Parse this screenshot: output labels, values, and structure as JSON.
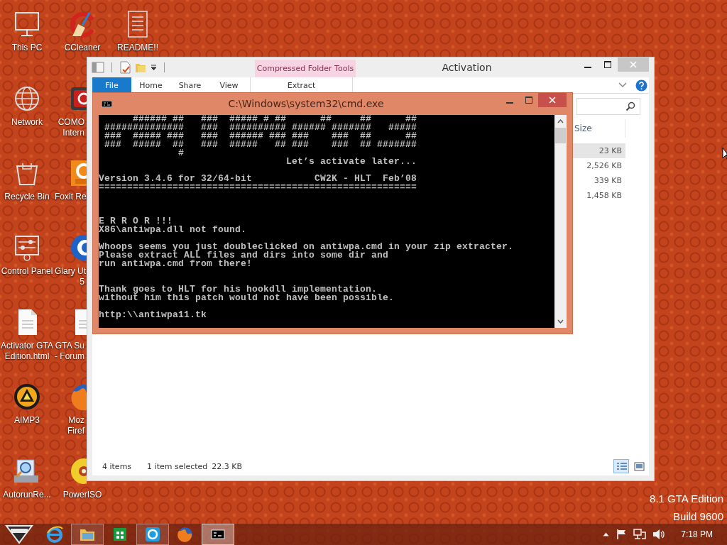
{
  "desktop": {
    "icons": [
      {
        "label": "This PC",
        "cut": false,
        "icon_covered": false
      },
      {
        "label": "Network",
        "cut": false,
        "icon_covered": false
      },
      {
        "label": "Recycle Bin",
        "cut": false,
        "icon_covered": false
      },
      {
        "label": "Control Panel",
        "cut": false,
        "icon_covered": false
      },
      {
        "label": "Activator GTA\nEdition.html",
        "cut": false,
        "icon_covered": false
      },
      {
        "label": "AIMP3",
        "cut": false,
        "icon_covered": false
      },
      {
        "label": "AutorunRe...",
        "cut": false,
        "icon_covered": false
      },
      {
        "label": "CCleaner",
        "cut": false,
        "icon_covered": false
      },
      {
        "label": "COMO\nIntern",
        "cut": true,
        "icon_covered": true
      },
      {
        "label": "Foxit Re",
        "cut": true,
        "icon_covered": true
      },
      {
        "label": "Glary Ut\n5",
        "cut": true,
        "icon_covered": true
      },
      {
        "label": "GTA Su\n- Forum",
        "cut": true,
        "icon_covered": true
      },
      {
        "label": "Moz\nFiref",
        "cut": true,
        "icon_covered": true
      },
      {
        "label": "PowerISO",
        "cut": false,
        "icon_covered": true
      },
      {
        "label": "README!!",
        "cut": false,
        "icon_covered": false
      }
    ],
    "edition_lines": [
      "8.1 GTA Edition",
      "Build 9600"
    ]
  },
  "explorer": {
    "title": "Activation",
    "contextual_tab": "Compressed Folder Tools",
    "tabs": [
      {
        "label": "File",
        "kind": "file",
        "selected": false
      },
      {
        "label": "Home",
        "kind": "tab",
        "selected": false
      },
      {
        "label": "Share",
        "kind": "tab",
        "selected": false
      },
      {
        "label": "View",
        "kind": "tab",
        "selected": false
      },
      {
        "label": "Extract",
        "kind": "contextual",
        "selected": false
      }
    ],
    "files": {
      "columns": [
        "Size"
      ],
      "rows": [
        {
          "size": "23 KB",
          "selected": true
        },
        {
          "size": "2,526 KB",
          "selected": false
        },
        {
          "size": "339 KB",
          "selected": false
        },
        {
          "size": "1,458 KB",
          "selected": false
        }
      ]
    },
    "status_bar": {
      "item_count": "4 items",
      "selection": "1 item selected",
      "selection_size": "22.3 KB"
    },
    "view_buttons": [
      {
        "selected": true
      },
      {
        "selected": false
      }
    ]
  },
  "cmd": {
    "title": "C:\\Windows\\system32\\cmd.exe",
    "output": "      ###### ##   ###  ##### # ##      ##     ##      ##\n ##############   ###  ########## ###### #######   #####\n ###  ##### ###   ###  ###### ### ###    ###  ##      ##\n ###  #####  ##   ###  #####   ## ###    ###  ## #######\n              #\n                                 Let’s activate later...\n\nVersion 3.4.6 for 32/64-bit           CW2K - HLT  Feb’08\n========================================================\n\n\n\nE R R O R !!!\nX86\\antiwpa.dll not found.\n\nWhoops seems you just doubleclicked on antiwpa.cmd in your zip extracter.\nPlease extract ALL files and dirs into some dir and\nrun antiwpa.cmd from there!\n\n\nThank goes to HLT for his hookdll implementation.\nwithout him this patch would not have been possible.\n\nhttp:\\\\antiwpa11.tk"
  },
  "taskbar": {
    "buttons": [
      {
        "running": false,
        "selected": false
      },
      {
        "running": false,
        "selected": false
      },
      {
        "running": true,
        "selected": false
      },
      {
        "running": false,
        "selected": false
      },
      {
        "running": true,
        "selected": false
      },
      {
        "running": false,
        "selected": false
      },
      {
        "running": true,
        "selected": true
      }
    ],
    "clock": "7:18 PM"
  }
}
